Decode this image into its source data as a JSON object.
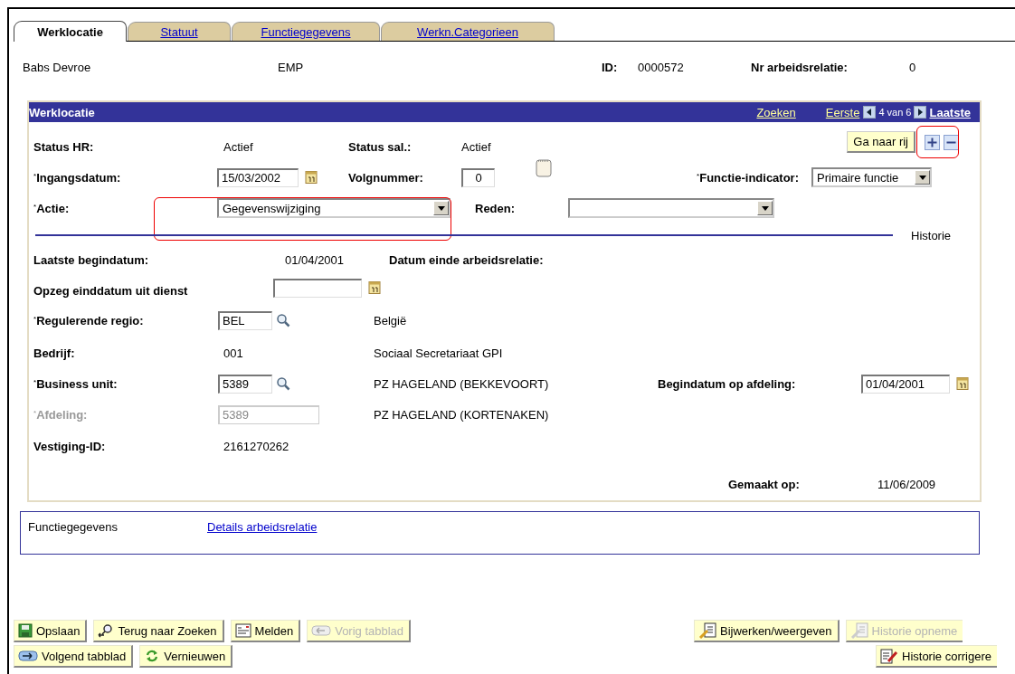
{
  "tabs": [
    {
      "label": "Werklocatie",
      "selected": true
    },
    {
      "label": "Statuut",
      "selected": false
    },
    {
      "label": "Functiegegevens",
      "selected": false
    },
    {
      "label": "Werkn.Categorieen",
      "selected": false
    }
  ],
  "header": {
    "name": "Babs Devroe",
    "type": "EMP",
    "id_label": "ID:",
    "id_value": "0000572",
    "relation_label": "Nr arbeidsrelatie:",
    "relation_value": "0"
  },
  "panel": {
    "title": "Werklocatie",
    "nav": {
      "search": "Zoeken",
      "first": "Eerste",
      "position": "4 van 6",
      "last": "Laatste"
    },
    "rows": [
      {
        "kind": "fields",
        "disabled": false,
        "cells": [
          {
            "kind": "label",
            "text": "Status HR:"
          },
          {
            "kind": "text",
            "text": "Actief"
          },
          {
            "kind": "label",
            "text": "Status sal.:"
          },
          {
            "kind": "text",
            "text": "Actief"
          },
          {
            "kind": "row-controls",
            "button": "Ga naar rij",
            "add_highlighted": true
          }
        ]
      },
      {
        "kind": "fields",
        "disabled": false,
        "cells": [
          {
            "kind": "label",
            "text": "$^{*}$Ingangsdatum:"
          },
          {
            "kind": "input",
            "value": "15/03/2002",
            "calendar": true,
            "lookup": false
          },
          {
            "kind": "label",
            "text": "Volgnummer:"
          },
          {
            "kind": "input",
            "value": "0",
            "calendar": false,
            "lookup": false
          },
          {
            "kind": "note"
          },
          {
            "kind": "label",
            "text": "$^{*}$Functie-indicator:"
          },
          {
            "kind": "select",
            "value": "Primaire functie",
            "highlighted": false
          }
        ]
      },
      {
        "kind": "fields",
        "disabled": false,
        "cells": [
          {
            "kind": "label",
            "text": "$^{*}$Actie:"
          },
          {
            "kind": "select",
            "value": "Gegevenswijziging",
            "highlighted": true
          },
          {
            "kind": "label",
            "text": "Reden:"
          },
          {
            "kind": "select",
            "highlighted": false
          }
        ]
      },
      {
        "kind": "divider",
        "label": "Historie"
      },
      {
        "kind": "fields",
        "disabled": false,
        "cells": [
          {
            "kind": "label",
            "text": "Laatste begindatum:"
          },
          {
            "kind": "text",
            "text": "01/04/2001"
          },
          {
            "kind": "label",
            "text": "Datum einde arbeidsrelatie:"
          }
        ]
      },
      {
        "kind": "fields",
        "disabled": false,
        "cells": [
          {
            "kind": "label",
            "text": "Opzeg einddatum uit dienst"
          },
          {
            "kind": "input",
            "calendar": true,
            "lookup": false
          }
        ]
      },
      {
        "kind": "fields",
        "disabled": false,
        "cells": [
          {
            "kind": "label",
            "text": "$^{*}$Regulerende regio:"
          },
          {
            "kind": "input",
            "value": "BEL",
            "calendar": false,
            "lookup": true
          },
          {
            "kind": "text",
            "text": "België"
          }
        ]
      },
      {
        "kind": "fields",
        "disabled": false,
        "cells": [
          {
            "kind": "label",
            "text": "Bedrijf:"
          },
          {
            "kind": "text",
            "text": "001"
          },
          {
            "kind": "text",
            "text": "Sociaal Secretariaat GPI"
          }
        ]
      },
      {
        "kind": "fields",
        "disabled": false,
        "cells": [
          {
            "kind": "label",
            "text": "$^{*}$Business unit:"
          },
          {
            "kind": "input",
            "value": "5389",
            "calendar": false,
            "lookup": true
          },
          {
            "kind": "text",
            "text": "PZ HAGELAND (BEKKEVOORT)"
          },
          {
            "kind": "label",
            "text": "Begindatum op afdeling:"
          },
          {
            "kind": "input",
            "value": "01/04/2001",
            "calendar": true,
            "lookup": false
          }
        ]
      },
      {
        "kind": "fields",
        "disabled": true,
        "cells": [
          {
            "kind": "label",
            "text": "$^{*}$Afdeling:"
          },
          {
            "kind": "input",
            "value": "5389",
            "calendar": false,
            "lookup": false
          },
          {
            "kind": "text",
            "text": "PZ HAGELAND (KORTENAKEN)"
          }
        ]
      },
      {
        "kind": "fields",
        "disabled": false,
        "cells": [
          {
            "kind": "label",
            "text": "Vestiging-ID:"
          },
          {
            "kind": "text",
            "text": "2161270262"
          }
        ]
      },
      {
        "kind": "fields",
        "disabled": false,
        "cells": [
          {
            "kind": "label",
            "text": "Gemaakt op:"
          },
          {
            "kind": "text",
            "text": "11/06/2009"
          }
        ]
      }
    ]
  },
  "links_box": {
    "label": "Functiegegevens",
    "link": "Details arbeidsrelatie"
  },
  "toolbar": [
    {
      "left": [
        {
          "label": "Opslaan",
          "kind": "save",
          "disabled": false
        },
        {
          "label": "Terug naar Zoeken",
          "kind": "return",
          "disabled": false
        },
        {
          "label": "Melden",
          "kind": "notify",
          "disabled": false
        },
        {
          "label": "Vorig tabblad",
          "kind": "previous",
          "disabled": true
        }
      ],
      "right": [
        {
          "label": "Bijwerken/weergeven",
          "kind": "edit",
          "disabled": false
        },
        {
          "label": "Historie opneme",
          "kind": "history",
          "disabled": true
        }
      ]
    },
    {
      "left": [
        {
          "label": "Volgend tabblad",
          "kind": "next",
          "disabled": false
        },
        {
          "label": "Vernieuwen",
          "kind": "refresh",
          "disabled": false
        }
      ],
      "right": [
        {
          "label": "Historie corrigere",
          "kind": "correct",
          "disabled": false
        }
      ]
    }
  ]
}
